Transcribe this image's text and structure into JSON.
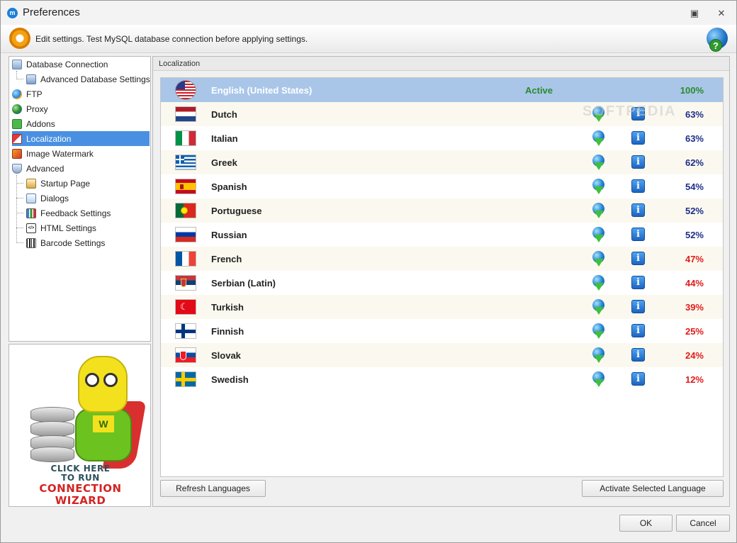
{
  "window": {
    "title": "Preferences"
  },
  "header": {
    "text": "Edit settings. Test MySQL database connection before applying settings."
  },
  "nav": {
    "items": [
      {
        "label": "Database Connection"
      },
      {
        "label": "Advanced Database Settings"
      },
      {
        "label": "FTP"
      },
      {
        "label": "Proxy"
      },
      {
        "label": "Addons"
      },
      {
        "label": "Localization"
      },
      {
        "label": "Image Watermark"
      },
      {
        "label": "Advanced"
      },
      {
        "label": "Startup Page"
      },
      {
        "label": "Dialogs"
      },
      {
        "label": "Feedback Settings"
      },
      {
        "label": "HTML Settings"
      },
      {
        "label": "Barcode Settings"
      }
    ],
    "selected": "Localization"
  },
  "wizard": {
    "line1": "CLICK HERE",
    "line2": "TO RUN",
    "line3": "CONNECTION",
    "line4": "WIZARD",
    "emblem": "W"
  },
  "content": {
    "section_title": "Localization",
    "languages": [
      {
        "name": "English (United States)",
        "status": "Active",
        "percent": "100%"
      },
      {
        "name": "Dutch",
        "status": "",
        "percent": "63%"
      },
      {
        "name": "Italian",
        "status": "",
        "percent": "63%"
      },
      {
        "name": "Greek",
        "status": "",
        "percent": "62%"
      },
      {
        "name": "Spanish",
        "status": "",
        "percent": "54%"
      },
      {
        "name": "Portuguese",
        "status": "",
        "percent": "52%"
      },
      {
        "name": "Russian",
        "status": "",
        "percent": "52%"
      },
      {
        "name": "French",
        "status": "",
        "percent": "47%"
      },
      {
        "name": "Serbian (Latin)",
        "status": "",
        "percent": "44%"
      },
      {
        "name": "Turkish",
        "status": "",
        "percent": "39%"
      },
      {
        "name": "Finnish",
        "status": "",
        "percent": "25%"
      },
      {
        "name": "Slovak",
        "status": "",
        "percent": "24%"
      },
      {
        "name": "Swedish",
        "status": "",
        "percent": "12%"
      }
    ],
    "refresh_label": "Refresh Languages",
    "activate_label": "Activate Selected Language",
    "info_glyph": "i",
    "watermark": "SOFTPEDIA"
  },
  "footer": {
    "ok_label": "OK",
    "cancel_label": "Cancel"
  },
  "colors": {
    "selection": "#4a90e2",
    "active_row": "#a9c6e9",
    "percent_high": "#1e2d8a",
    "percent_low": "#e01b1b",
    "active_text": "#2a8a2a"
  }
}
